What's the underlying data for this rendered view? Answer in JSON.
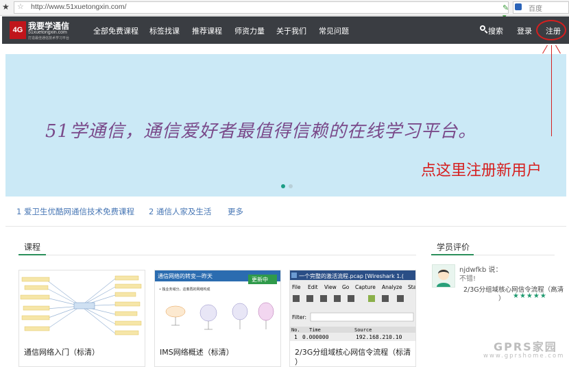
{
  "browser": {
    "url": "http://www.51xuetongxin.com/",
    "search_engine": "百度"
  },
  "logo": {
    "badge": "4G",
    "title": "我要学通信",
    "domain": "51xuetongxin.com",
    "slogan": "打造最佳通信技术学习平台"
  },
  "nav": {
    "items": [
      "全部免费课程",
      "标签找课",
      "推荐课程",
      "师资力量",
      "关于我们",
      "常见问题"
    ],
    "search": "搜索",
    "login": "登录",
    "register": "注册"
  },
  "banner": {
    "slogan": "51学通信，通信爱好者最值得信赖的在线学习平台。"
  },
  "annotation": {
    "text": "点这里注册新用户",
    "color": "#d61f1f"
  },
  "topics": [
    "1 爱卫生优酷网通信技术免费课程",
    "2 通信人家及生活",
    "更多"
  ],
  "sections": {
    "courses": "课程",
    "reviews": "学员评价"
  },
  "courses": [
    {
      "title": "通信网络入门（标清）"
    },
    {
      "title": "IMS网络概述（标清）",
      "thumb_title": "通信网络的转变—昨天",
      "thumb_badge": "更新中",
      "thumb_bullet": "• 独业务域分，这奏再的网络构成"
    },
    {
      "title": "2/3G分组域核心网信令流程（标清",
      "title_cont": "）",
      "thumb_title": "一个完整的激活流程.pcap  [Wireshark 1.(",
      "thumb_menu": [
        "File",
        "Edit",
        "View",
        "Go",
        "Capture",
        "Analyze",
        "Sta"
      ],
      "thumb_filter": "Filter:",
      "thumb_cols": [
        "No.",
        "Time",
        "Source"
      ],
      "thumb_row": [
        "1",
        "0.000000",
        "192.168.210.10"
      ]
    }
  ],
  "review": {
    "user": "njdwfkb",
    "said": "说：",
    "text": "不错!",
    "course": "2/3G分组域核心网信令流程（高清",
    "course_cont": "）",
    "stars": "★★★★★"
  },
  "watermark": {
    "text": "GPRS家园",
    "url": "www.gprshome.com"
  }
}
